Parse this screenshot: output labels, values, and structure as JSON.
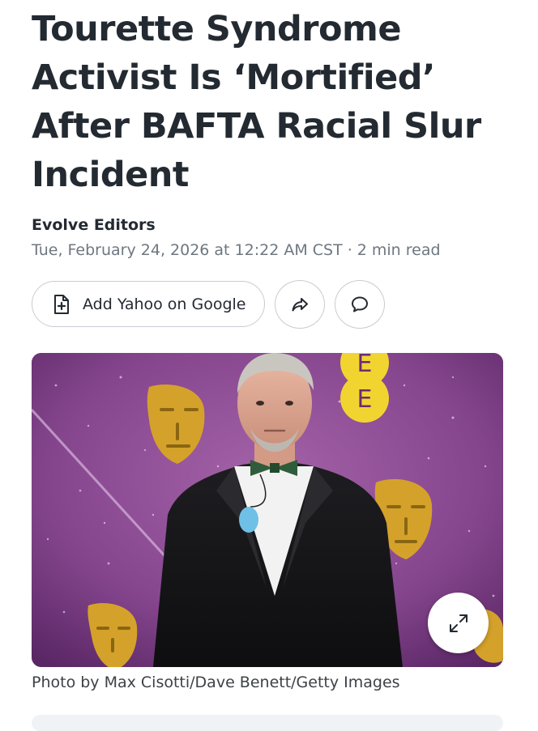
{
  "article": {
    "headline": "Tourette Syndrome Activist Is ‘Mortified’ After BAFTA Racial Slur Incident",
    "author": "Evolve Editors",
    "date": "Tue, February 24, 2026 at 12:22 AM CST",
    "separator": "·",
    "read_time": "2 min read"
  },
  "actions": {
    "google_label": "Add Yahoo on Google",
    "google_icon": "document-plus-icon",
    "share_icon": "share-arrow-icon",
    "comment_icon": "comment-bubble-icon"
  },
  "hero": {
    "caption": "Photo by Max Cisotti/Dave Benett/Getty Images",
    "expand_icon": "expand-icon",
    "backdrop_color": "#8a4a92",
    "mask_color": "#d4a22a",
    "logo_letter": "E"
  }
}
